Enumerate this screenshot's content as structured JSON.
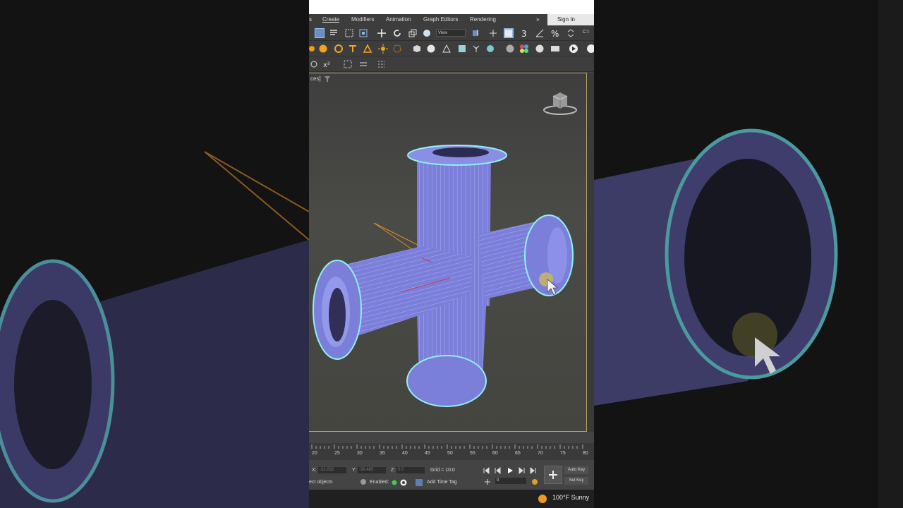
{
  "menu": {
    "partial_left": "s",
    "items": [
      "Create",
      "Modifiers",
      "Animation",
      "Graph Editors",
      "Rendering"
    ],
    "overflow": "»",
    "sign_in": "Sign In"
  },
  "toolbar": {
    "view_dropdown": "View",
    "partial_right": "C:\\"
  },
  "viewport": {
    "label": "ces]",
    "filter_icon": "funnel-icon",
    "nav_cube": "viewcube-icon"
  },
  "timeline": {
    "ticks": [
      "20",
      "25",
      "30",
      "35",
      "40",
      "45",
      "50",
      "55",
      "60",
      "65",
      "70",
      "75",
      "80"
    ]
  },
  "status": {
    "x_label": "X:",
    "x_value": "-32.832",
    "y_label": "Y:",
    "y_value": "-99.485",
    "z_label": "Z:",
    "z_value": "0.0",
    "grid": "Grid = 10.0",
    "selection_hint": "ect objects",
    "enabled_label": "Enabled:",
    "add_time_tag": "Add Time Tag",
    "frame_value": "0",
    "auto_key": "Auto Key",
    "set_key": "Set Key"
  },
  "taskbar": {
    "weather": "100°F  Sunny"
  },
  "colors": {
    "mesh_fill": "#7b7fd9",
    "mesh_edge": "#d7dcff",
    "selection_outline": "#8ff0f2",
    "viewport_border": "#b8a066",
    "menu_bg": "#3d3d3d",
    "accent_orange": "#f29a1c"
  }
}
